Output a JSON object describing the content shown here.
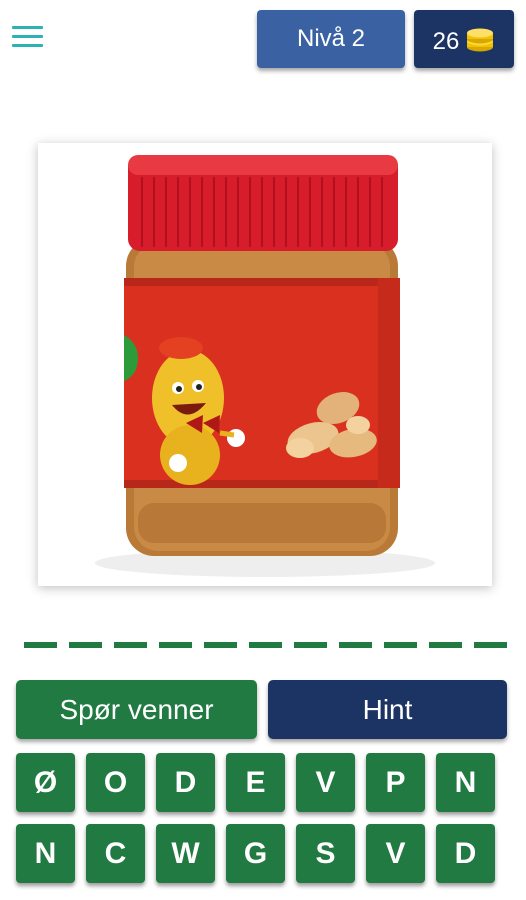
{
  "header": {
    "menu_icon": "hamburger-menu-icon",
    "level_label": "Nivå 2",
    "coins": "26",
    "coin_icon": "coin-stack-icon"
  },
  "puzzle": {
    "picture_description_icon": "peanut-butter-jar-image",
    "answer_slot_count": 11
  },
  "actions": {
    "ask_friends_label": "Spør venner",
    "hint_label": "Hint"
  },
  "keyboard": {
    "letters": [
      "Ø",
      "O",
      "D",
      "E",
      "V",
      "P",
      "N",
      "N",
      "C",
      "W",
      "G",
      "S",
      "V",
      "D"
    ]
  },
  "colors": {
    "menu_accent": "#2bb3b3",
    "level_button": "#3a62a3",
    "dark_navy": "#1b3464",
    "green": "#217a42",
    "coin_gold": "#f2c200"
  }
}
